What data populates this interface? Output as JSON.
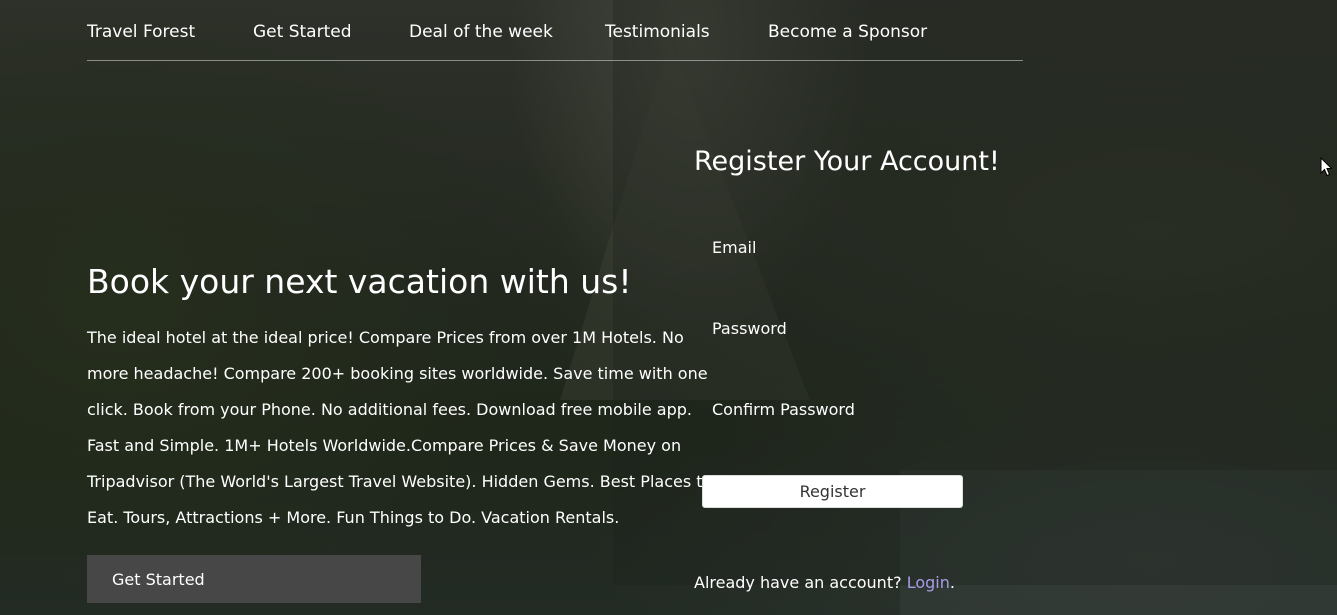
{
  "nav": {
    "items": [
      {
        "label": "Travel Forest"
      },
      {
        "label": "Get Started"
      },
      {
        "label": "Deal of the week"
      },
      {
        "label": "Testimonials"
      },
      {
        "label": "Become a Sponsor"
      }
    ]
  },
  "hero": {
    "title": "Book your next vacation with us!",
    "description": "The ideal hotel at the ideal price! Compare Prices from over 1M Hotels. No more headache! Compare 200+ booking sites worldwide. Save time with one click. Book from your Phone. No additional fees. Download free mobile app. Fast and Simple. 1M+ Hotels Worldwide.Compare Prices & Save Money on Tripadvisor (The World's Largest Travel Website). Hidden Gems. Best Places to Eat. Tours, Attractions + More. Fun Things to Do. Vacation Rentals.",
    "button_label": "Get Started"
  },
  "register": {
    "title": "Register Your Account!",
    "email_label": "Email",
    "email_value": "",
    "password_label": "Password",
    "password_value": "",
    "confirm_label": "Confirm Password",
    "confirm_value": "",
    "button_label": "Register",
    "login_prompt": "Already have an account?",
    "login_link": "Login",
    "login_suffix": "."
  },
  "colors": {
    "link": "#a89be8",
    "button_bg": "#474747",
    "register_bg": "#ffffff"
  },
  "icons": {
    "cursor": "mouse-pointer-icon"
  }
}
